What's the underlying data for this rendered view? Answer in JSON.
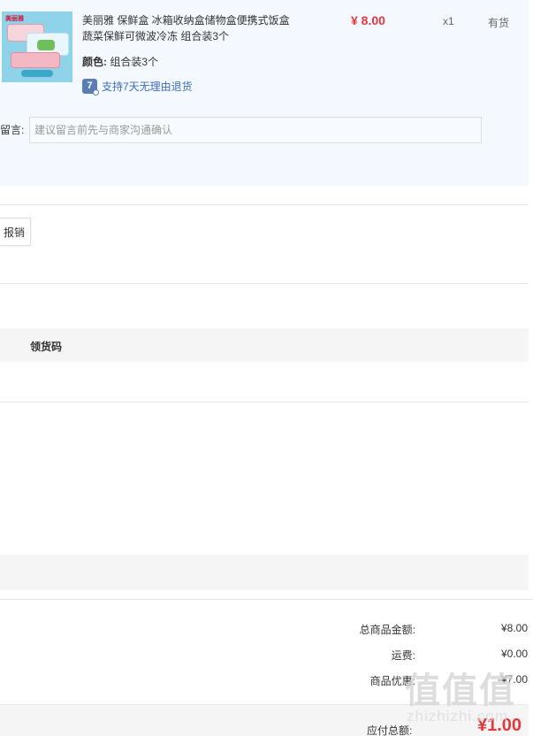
{
  "product": {
    "title_line1": "美丽雅 保鲜盒 冰箱收纳盒储物盒便携式饭盒",
    "title_line2": "蔬菜保鲜可微波冷冻 组合装3个",
    "price": "¥ 8.00",
    "quantity": "x1",
    "stock_status": "有货",
    "spec_label": "颜色:",
    "spec_value": "组合装3个",
    "return_policy": "支持7天无理由退货",
    "return_icon_text": "7",
    "image_icon": "food-container-product-image",
    "brand_mark": "美丽雅"
  },
  "remark": {
    "label": "留言:",
    "placeholder": "建议留言前先与商家沟通确认"
  },
  "reimburse": {
    "label": "报销"
  },
  "pickup": {
    "header": "领货码"
  },
  "summary": {
    "items": [
      {
        "label": "总商品金额:",
        "value": "¥8.00"
      },
      {
        "label": "运费:",
        "value": "¥0.00"
      },
      {
        "label": "商品优惠:",
        "value": "-¥7.00"
      }
    ],
    "payable_label": "应付总额:",
    "payable_value": "¥1.00"
  },
  "watermark": {
    "logo": "值值值",
    "text": "zhizhizhi.com"
  },
  "colors": {
    "price_red": "#e4393c",
    "panel_bg": "#f3f9ff",
    "link_blue": "#3e6dbd",
    "band_gray": "#f5f5f5"
  }
}
